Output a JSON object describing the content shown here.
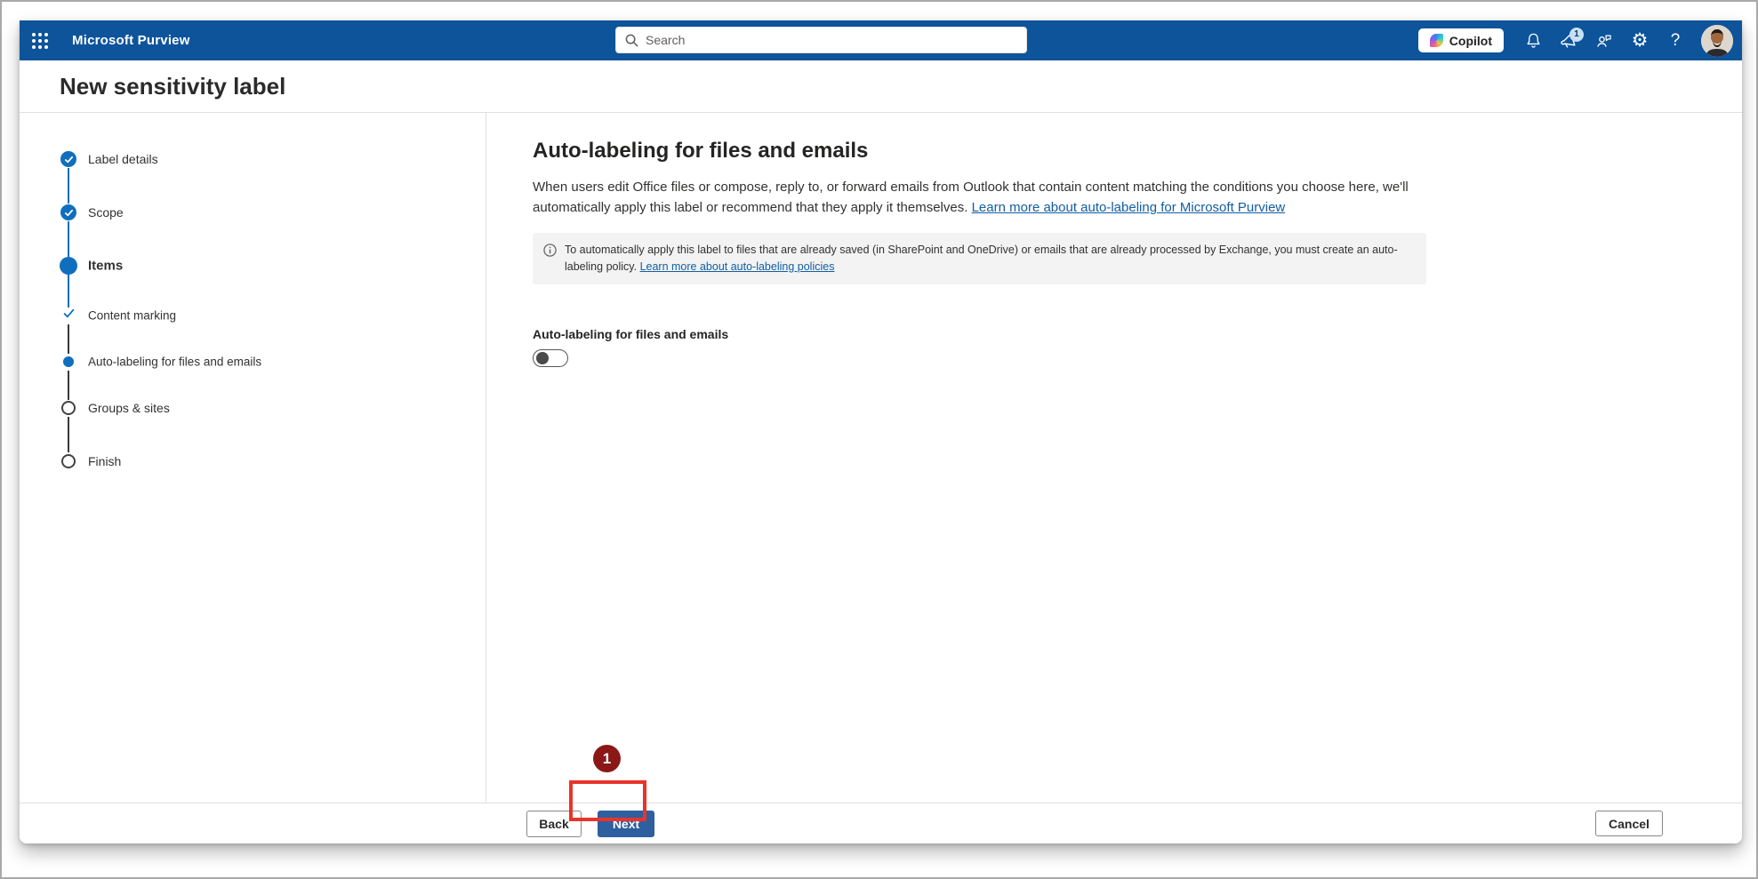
{
  "topbar": {
    "app_title": "Microsoft Purview",
    "search_placeholder": "Search",
    "copilot_label": "Copilot",
    "notification_badge": "1",
    "gear_glyph": "⚙",
    "question_glyph": "?",
    "color_accent": "#0d549b"
  },
  "page": {
    "title": "New sensitivity label"
  },
  "wizard": {
    "steps": [
      {
        "label": "Label details",
        "state": "completed"
      },
      {
        "label": "Scope",
        "state": "completed"
      },
      {
        "label": "Items",
        "state": "current",
        "substeps": [
          {
            "label": "Content marking",
            "state": "completed"
          },
          {
            "label": "Auto-labeling for files and emails",
            "state": "current"
          }
        ]
      },
      {
        "label": "Groups & sites",
        "state": "upcoming"
      },
      {
        "label": "Finish",
        "state": "upcoming"
      }
    ]
  },
  "main": {
    "heading": "Auto-labeling for files and emails",
    "description": "When users edit Office files or compose, reply to, or forward emails from Outlook that contain content matching the conditions you choose here, we'll automatically apply this label or recommend that they apply it themselves.",
    "description_link": "Learn more about auto-labeling for Microsoft Purview",
    "info_banner": {
      "text": "To automatically apply this label to files that are already saved (in SharePoint and OneDrive) or emails that are already processed by Exchange, you must create an auto-labeling policy.",
      "link": "Learn more about auto-labeling policies"
    },
    "toggle": {
      "label": "Auto-labeling for files and emails",
      "state": "off"
    }
  },
  "footer": {
    "back_label": "Back",
    "next_label": "Next",
    "cancel_label": "Cancel"
  },
  "annotation": {
    "number": "1",
    "rect_color": "#e8342a",
    "circle_color": "#8c1717"
  }
}
